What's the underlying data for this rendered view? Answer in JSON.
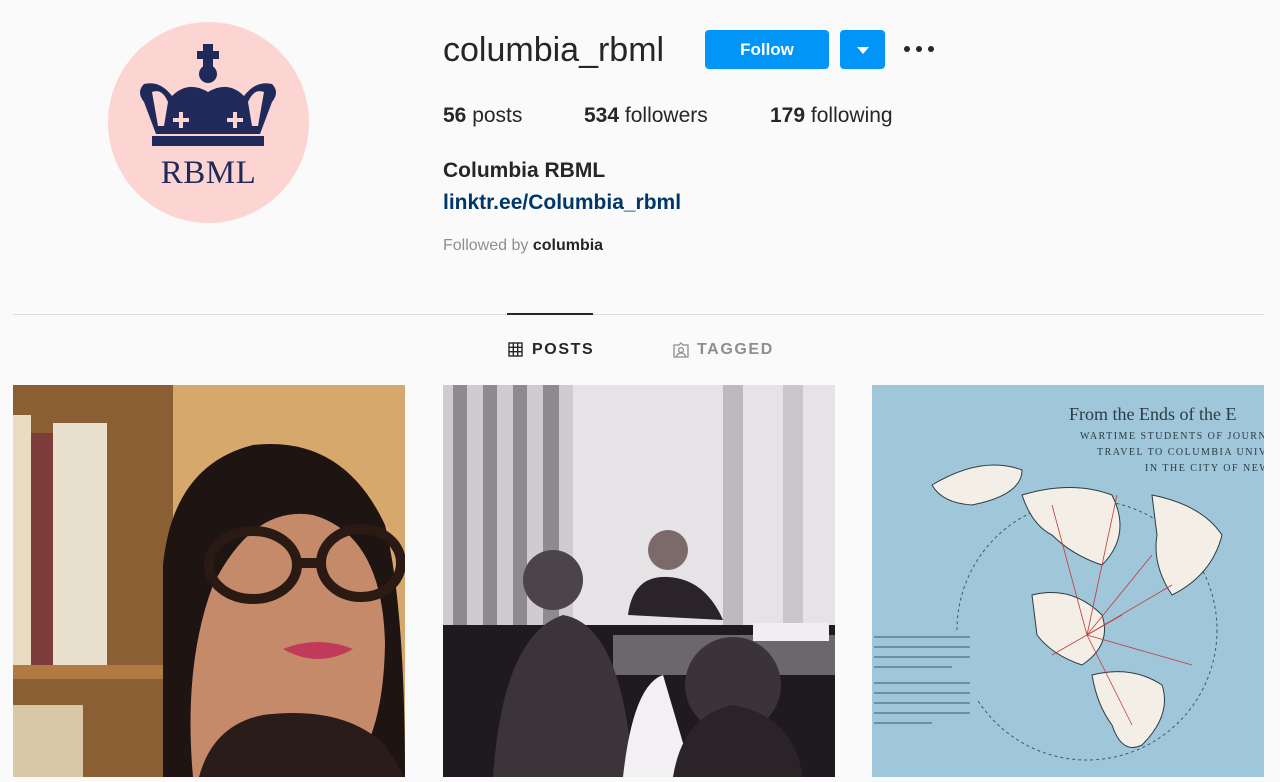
{
  "profile": {
    "username": "columbia_rbml",
    "avatar_text": "RBML",
    "full_name": "Columbia RBML",
    "link": "linktr.ee/Columbia_rbml",
    "followed_by_prefix": "Followed by",
    "followed_by_user": "columbia"
  },
  "actions": {
    "follow_label": "Follow",
    "dropdown_icon": "chevron-down-icon",
    "more_icon": "more-options-icon"
  },
  "stats": {
    "posts_count": "56",
    "posts_label": "posts",
    "followers_count": "534",
    "followers_label": "followers",
    "following_count": "179",
    "following_label": "following"
  },
  "tabs": [
    {
      "label": "POSTS",
      "icon": "grid-icon",
      "active": true
    },
    {
      "label": "TAGGED",
      "icon": "tagged-icon",
      "active": false
    }
  ],
  "posts": [
    {
      "kind": "photo",
      "subject": "portrait"
    },
    {
      "kind": "photo",
      "subject": "meeting"
    },
    {
      "kind": "map",
      "title": "From the Ends of the E",
      "line1": "WARTIME STUDENTS OF JOURN",
      "line2": "TRAVEL TO COLUMBIA UNIV",
      "line3": "IN THE CITY OF NEW"
    }
  ],
  "colors": {
    "accent": "#0095f6",
    "link": "#00376b",
    "avatar_bg": "#fcd5d3",
    "crown": "#1f2a5b",
    "map_bg": "#9fc6d9"
  }
}
